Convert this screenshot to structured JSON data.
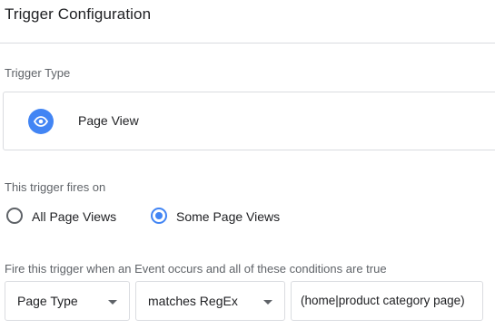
{
  "header": {
    "title": "Trigger Configuration"
  },
  "trigger_type": {
    "label": "Trigger Type",
    "selected_name": "Page View",
    "icon": "eye-icon",
    "icon_color": "#4285f4"
  },
  "fires_on": {
    "label": "This trigger fires on",
    "options": [
      {
        "label": "All Page Views",
        "checked": false
      },
      {
        "label": "Some Page Views",
        "checked": true
      }
    ]
  },
  "conditions": {
    "label": "Fire this trigger when an Event occurs and all of these conditions are true",
    "variable": "Page Type",
    "operator": "matches RegEx",
    "value": "(home|product category page)"
  },
  "colors": {
    "accent": "#4285f4",
    "border": "#dadce0",
    "secondary_text": "#5f6368"
  }
}
